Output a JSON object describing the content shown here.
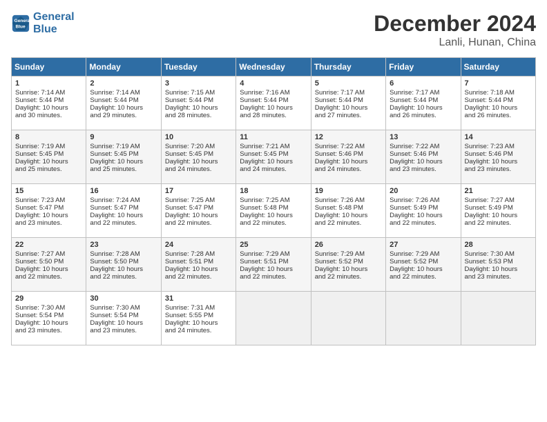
{
  "header": {
    "logo_line1": "General",
    "logo_line2": "Blue",
    "month": "December 2024",
    "location": "Lanli, Hunan, China"
  },
  "weekdays": [
    "Sunday",
    "Monday",
    "Tuesday",
    "Wednesday",
    "Thursday",
    "Friday",
    "Saturday"
  ],
  "weeks": [
    [
      {
        "day": "1",
        "lines": [
          "Sunrise: 7:14 AM",
          "Sunset: 5:44 PM",
          "Daylight: 10 hours",
          "and 30 minutes."
        ]
      },
      {
        "day": "2",
        "lines": [
          "Sunrise: 7:14 AM",
          "Sunset: 5:44 PM",
          "Daylight: 10 hours",
          "and 29 minutes."
        ]
      },
      {
        "day": "3",
        "lines": [
          "Sunrise: 7:15 AM",
          "Sunset: 5:44 PM",
          "Daylight: 10 hours",
          "and 28 minutes."
        ]
      },
      {
        "day": "4",
        "lines": [
          "Sunrise: 7:16 AM",
          "Sunset: 5:44 PM",
          "Daylight: 10 hours",
          "and 28 minutes."
        ]
      },
      {
        "day": "5",
        "lines": [
          "Sunrise: 7:17 AM",
          "Sunset: 5:44 PM",
          "Daylight: 10 hours",
          "and 27 minutes."
        ]
      },
      {
        "day": "6",
        "lines": [
          "Sunrise: 7:17 AM",
          "Sunset: 5:44 PM",
          "Daylight: 10 hours",
          "and 26 minutes."
        ]
      },
      {
        "day": "7",
        "lines": [
          "Sunrise: 7:18 AM",
          "Sunset: 5:44 PM",
          "Daylight: 10 hours",
          "and 26 minutes."
        ]
      }
    ],
    [
      {
        "day": "8",
        "lines": [
          "Sunrise: 7:19 AM",
          "Sunset: 5:45 PM",
          "Daylight: 10 hours",
          "and 25 minutes."
        ]
      },
      {
        "day": "9",
        "lines": [
          "Sunrise: 7:19 AM",
          "Sunset: 5:45 PM",
          "Daylight: 10 hours",
          "and 25 minutes."
        ]
      },
      {
        "day": "10",
        "lines": [
          "Sunrise: 7:20 AM",
          "Sunset: 5:45 PM",
          "Daylight: 10 hours",
          "and 24 minutes."
        ]
      },
      {
        "day": "11",
        "lines": [
          "Sunrise: 7:21 AM",
          "Sunset: 5:45 PM",
          "Daylight: 10 hours",
          "and 24 minutes."
        ]
      },
      {
        "day": "12",
        "lines": [
          "Sunrise: 7:22 AM",
          "Sunset: 5:46 PM",
          "Daylight: 10 hours",
          "and 24 minutes."
        ]
      },
      {
        "day": "13",
        "lines": [
          "Sunrise: 7:22 AM",
          "Sunset: 5:46 PM",
          "Daylight: 10 hours",
          "and 23 minutes."
        ]
      },
      {
        "day": "14",
        "lines": [
          "Sunrise: 7:23 AM",
          "Sunset: 5:46 PM",
          "Daylight: 10 hours",
          "and 23 minutes."
        ]
      }
    ],
    [
      {
        "day": "15",
        "lines": [
          "Sunrise: 7:23 AM",
          "Sunset: 5:47 PM",
          "Daylight: 10 hours",
          "and 23 minutes."
        ]
      },
      {
        "day": "16",
        "lines": [
          "Sunrise: 7:24 AM",
          "Sunset: 5:47 PM",
          "Daylight: 10 hours",
          "and 22 minutes."
        ]
      },
      {
        "day": "17",
        "lines": [
          "Sunrise: 7:25 AM",
          "Sunset: 5:47 PM",
          "Daylight: 10 hours",
          "and 22 minutes."
        ]
      },
      {
        "day": "18",
        "lines": [
          "Sunrise: 7:25 AM",
          "Sunset: 5:48 PM",
          "Daylight: 10 hours",
          "and 22 minutes."
        ]
      },
      {
        "day": "19",
        "lines": [
          "Sunrise: 7:26 AM",
          "Sunset: 5:48 PM",
          "Daylight: 10 hours",
          "and 22 minutes."
        ]
      },
      {
        "day": "20",
        "lines": [
          "Sunrise: 7:26 AM",
          "Sunset: 5:49 PM",
          "Daylight: 10 hours",
          "and 22 minutes."
        ]
      },
      {
        "day": "21",
        "lines": [
          "Sunrise: 7:27 AM",
          "Sunset: 5:49 PM",
          "Daylight: 10 hours",
          "and 22 minutes."
        ]
      }
    ],
    [
      {
        "day": "22",
        "lines": [
          "Sunrise: 7:27 AM",
          "Sunset: 5:50 PM",
          "Daylight: 10 hours",
          "and 22 minutes."
        ]
      },
      {
        "day": "23",
        "lines": [
          "Sunrise: 7:28 AM",
          "Sunset: 5:50 PM",
          "Daylight: 10 hours",
          "and 22 minutes."
        ]
      },
      {
        "day": "24",
        "lines": [
          "Sunrise: 7:28 AM",
          "Sunset: 5:51 PM",
          "Daylight: 10 hours",
          "and 22 minutes."
        ]
      },
      {
        "day": "25",
        "lines": [
          "Sunrise: 7:29 AM",
          "Sunset: 5:51 PM",
          "Daylight: 10 hours",
          "and 22 minutes."
        ]
      },
      {
        "day": "26",
        "lines": [
          "Sunrise: 7:29 AM",
          "Sunset: 5:52 PM",
          "Daylight: 10 hours",
          "and 22 minutes."
        ]
      },
      {
        "day": "27",
        "lines": [
          "Sunrise: 7:29 AM",
          "Sunset: 5:52 PM",
          "Daylight: 10 hours",
          "and 22 minutes."
        ]
      },
      {
        "day": "28",
        "lines": [
          "Sunrise: 7:30 AM",
          "Sunset: 5:53 PM",
          "Daylight: 10 hours",
          "and 23 minutes."
        ]
      }
    ],
    [
      {
        "day": "29",
        "lines": [
          "Sunrise: 7:30 AM",
          "Sunset: 5:54 PM",
          "Daylight: 10 hours",
          "and 23 minutes."
        ]
      },
      {
        "day": "30",
        "lines": [
          "Sunrise: 7:30 AM",
          "Sunset: 5:54 PM",
          "Daylight: 10 hours",
          "and 23 minutes."
        ]
      },
      {
        "day": "31",
        "lines": [
          "Sunrise: 7:31 AM",
          "Sunset: 5:55 PM",
          "Daylight: 10 hours",
          "and 24 minutes."
        ]
      },
      {
        "day": "",
        "lines": []
      },
      {
        "day": "",
        "lines": []
      },
      {
        "day": "",
        "lines": []
      },
      {
        "day": "",
        "lines": []
      }
    ]
  ]
}
